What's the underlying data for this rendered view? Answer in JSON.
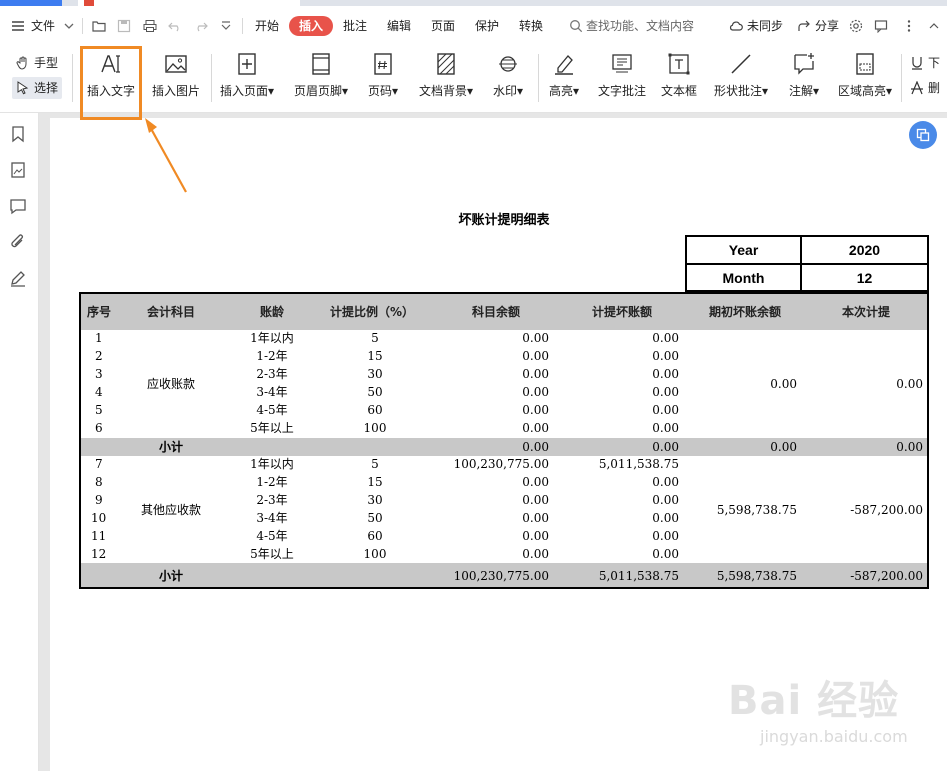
{
  "menubar": {
    "file": "文件",
    "tabs": [
      "开始",
      "插入",
      "批注",
      "编辑",
      "页面",
      "保护",
      "转换"
    ],
    "active_tab": "插入",
    "search_placeholder": "查找功能、文档内容",
    "sync": "未同步",
    "share": "分享"
  },
  "ribbon": {
    "hand_mode": "手型",
    "select_mode": "选择",
    "buttons": [
      "插入文字",
      "插入图片",
      "插入页面",
      "页眉页脚",
      "页码",
      "文档背景",
      "水印",
      "高亮",
      "文字批注",
      "文本框",
      "形状批注",
      "注解",
      "区域高亮"
    ],
    "cut_labels": [
      "下",
      "删"
    ]
  },
  "annotation": {
    "color": "#f08a24",
    "highlighted_button": "插入文字"
  },
  "document": {
    "title": "坏账计提明细表",
    "year_label": "Year",
    "year": "2020",
    "month_label": "Month",
    "month": "12",
    "columns": [
      "序号",
      "会计科目",
      "账龄",
      "计提比例（%）",
      "科目余额",
      "计提坏账额",
      "期初坏账余额",
      "本次计提"
    ],
    "groups": [
      {
        "account": "应收账款",
        "rows": [
          {
            "no": "1",
            "age": "1年以内",
            "rate": "5",
            "balance": "0.00",
            "provision": "0.00"
          },
          {
            "no": "2",
            "age": "1-2年",
            "rate": "15",
            "balance": "0.00",
            "provision": "0.00"
          },
          {
            "no": "3",
            "age": "2-3年",
            "rate": "30",
            "balance": "0.00",
            "provision": "0.00"
          },
          {
            "no": "4",
            "age": "3-4年",
            "rate": "50",
            "balance": "0.00",
            "provision": "0.00"
          },
          {
            "no": "5",
            "age": "4-5年",
            "rate": "60",
            "balance": "0.00",
            "provision": "0.00"
          },
          {
            "no": "6",
            "age": "5年以上",
            "rate": "100",
            "balance": "0.00",
            "provision": "0.00"
          }
        ],
        "opening": "0.00",
        "current": "0.00",
        "subtotal": {
          "label": "小计",
          "balance": "0.00",
          "provision": "0.00",
          "opening": "0.00",
          "current": "0.00"
        }
      },
      {
        "account": "其他应收款",
        "rows": [
          {
            "no": "7",
            "age": "1年以内",
            "rate": "5",
            "balance": "100,230,775.00",
            "provision": "5,011,538.75"
          },
          {
            "no": "8",
            "age": "1-2年",
            "rate": "15",
            "balance": "0.00",
            "provision": "0.00"
          },
          {
            "no": "9",
            "age": "2-3年",
            "rate": "30",
            "balance": "0.00",
            "provision": "0.00"
          },
          {
            "no": "10",
            "age": "3-4年",
            "rate": "50",
            "balance": "0.00",
            "provision": "0.00"
          },
          {
            "no": "11",
            "age": "4-5年",
            "rate": "60",
            "balance": "0.00",
            "provision": "0.00"
          },
          {
            "no": "12",
            "age": "5年以上",
            "rate": "100",
            "balance": "0.00",
            "provision": "0.00"
          }
        ],
        "opening": "5,598,738.75",
        "current": "-587,200.00",
        "subtotal": {
          "label": "小计",
          "balance": "100,230,775.00",
          "provision": "5,011,538.75",
          "opening": "5,598,738.75",
          "current": "-587,200.00"
        }
      }
    ]
  },
  "watermark": {
    "logo": "Bai 经验",
    "url": "jingyan.baidu.com"
  }
}
